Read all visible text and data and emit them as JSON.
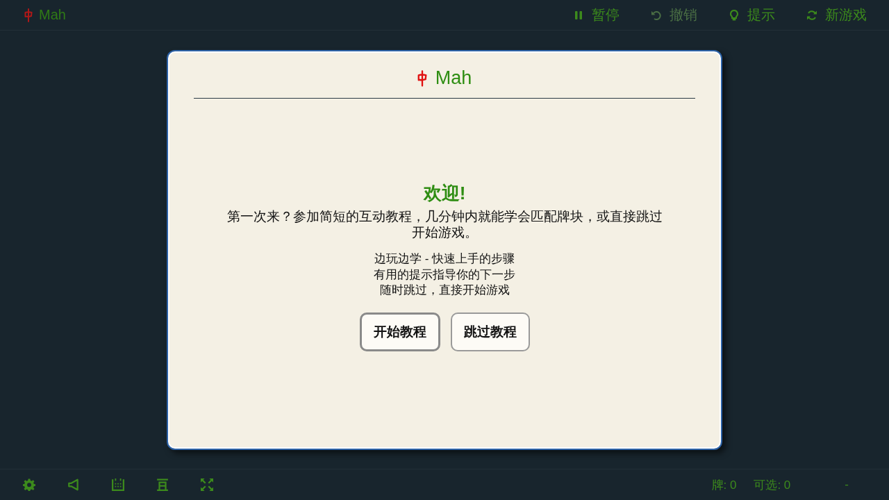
{
  "header": {
    "title": "Mah",
    "actions": [
      {
        "kind": "pause",
        "label": "暂停",
        "disabled": false
      },
      {
        "kind": "undo",
        "label": "撤销",
        "disabled": true
      },
      {
        "kind": "hint",
        "label": "提示",
        "disabled": false
      },
      {
        "kind": "new_game",
        "label": "新游戏",
        "disabled": false
      }
    ]
  },
  "dialog": {
    "title": "Mah",
    "heading": "欢迎!",
    "intro": "第一次来？参加简短的互动教程，几分钟内就能学会匹配牌块，或直接跳过开始游戏。",
    "points": [
      "边玩边学 - 快速上手的步骤",
      "有用的提示指导你的下一步",
      "随时跳过，直接开始游戏"
    ],
    "buttons": [
      {
        "label": "开始教程",
        "focused": true
      },
      {
        "label": "跳过教程",
        "focused": false
      }
    ]
  },
  "footer": {
    "stats": [
      "牌: 0",
      "可选: 0"
    ],
    "status": "-"
  }
}
